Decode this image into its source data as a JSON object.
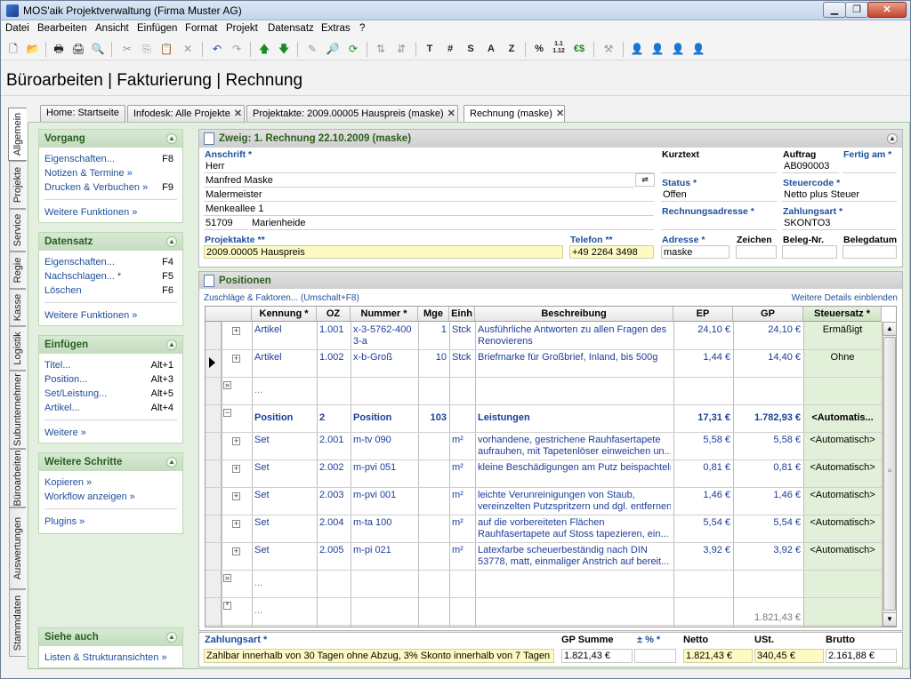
{
  "window": {
    "title": "MOS'aik Projektverwaltung (Firma Muster AG)"
  },
  "menu": [
    "Datei",
    "Bearbeiten",
    "Ansicht",
    "Einfügen",
    "Format",
    "Projekt",
    "Datensatz",
    "Extras",
    "?"
  ],
  "toolbar_text": [
    "T",
    "#",
    "S",
    "A",
    "Z",
    "%",
    "1.1 1.12",
    "€$"
  ],
  "page_title": "Büroarbeiten | Fakturierung | Rechnung",
  "vtabs": [
    "Allgemein",
    "Projekte",
    "Service",
    "Regie",
    "Kasse",
    "Logistik",
    "Subunternehmer",
    "Büroarbeiten",
    "Auswertungen",
    "Stammdaten"
  ],
  "doctabs": [
    {
      "label": "Home: Startseite",
      "closable": false
    },
    {
      "label": "Infodesk: Alle Projekte",
      "closable": true
    },
    {
      "label": "Projektakte: 2009.00005 Hauspreis (maske)",
      "closable": true
    },
    {
      "label": "Rechnung (maske)",
      "closable": true
    }
  ],
  "sidebar": {
    "vorgang": {
      "title": "Vorgang",
      "items": [
        {
          "label": "Eigenschaften...",
          "key": "F8"
        },
        {
          "label": "Notizen & Termine »",
          "key": ""
        },
        {
          "label": "Drucken & Verbuchen »",
          "key": "F9"
        }
      ],
      "more": "Weitere Funktionen »"
    },
    "datensatz": {
      "title": "Datensatz",
      "items": [
        {
          "label": "Eigenschaften...",
          "key": "F4"
        },
        {
          "label": "Nachschlagen... *",
          "key": "F5"
        },
        {
          "label": "Löschen",
          "key": "F6"
        }
      ],
      "more": "Weitere Funktionen »"
    },
    "einfuegen": {
      "title": "Einfügen",
      "items": [
        {
          "label": "Titel...",
          "key": "Alt+1"
        },
        {
          "label": "Position...",
          "key": "Alt+3"
        },
        {
          "label": "Set/Leistung...",
          "key": "Alt+5"
        },
        {
          "label": "Artikel...",
          "key": "Alt+4"
        }
      ],
      "more": "Weitere »"
    },
    "schritte": {
      "title": "Weitere Schritte",
      "items": [
        {
          "label": "Kopieren »",
          "key": ""
        },
        {
          "label": "Workflow anzeigen »",
          "key": ""
        }
      ],
      "more": "Plugins »"
    },
    "siehe": {
      "title": "Siehe auch",
      "items": [
        {
          "label": "Listen & Strukturansichten »",
          "key": ""
        }
      ]
    }
  },
  "zweig": {
    "title": "Zweig: 1. Rechnung 22.10.2009 (maske)",
    "anschrift_label": "Anschrift *",
    "anschrift": [
      "Herr",
      "Manfred Maske",
      "Malermeister",
      "Menkeallee 1"
    ],
    "plz": "51709",
    "ort": "Marienheide",
    "projektakte_label": "Projektakte **",
    "projektakte": "2009.00005 Hauspreis",
    "telefon_label": "Telefon **",
    "telefon": "+49 2264 3498",
    "kurztext_label": "Kurztext",
    "kurztext": "",
    "auftrag_label": "Auftrag",
    "auftrag": "AB090003",
    "fertig_label": "Fertig am *",
    "fertig": "",
    "status_label": "Status *",
    "status": "Offen",
    "steuercode_label": "Steuercode *",
    "steuercode": "Netto plus Steuer",
    "rechnungsadresse_label": "Rechnungsadresse *",
    "rechnungsadresse": "",
    "zahlungsart_label": "Zahlungsart *",
    "zahlungsart": "SKONTO3",
    "adresse_label": "Adresse *",
    "adresse": "maske",
    "zeichen_label": "Zeichen",
    "zeichen": "",
    "belegnr_label": "Beleg-Nr.",
    "belegnr": "",
    "belegdatum_label": "Belegdatum",
    "belegdatum": ""
  },
  "positionen": {
    "title": "Positionen",
    "link_left": "Zuschläge & Faktoren... (Umschalt+F8)",
    "link_right": "Weitere Details einblenden",
    "columns": [
      "Kennung *",
      "OZ",
      "Nummer *",
      "Mge",
      "Einh",
      "Beschreibung",
      "EP",
      "GP",
      "Steuersatz *"
    ],
    "rows": [
      {
        "kennung": "Artikel",
        "oz": "1.001",
        "nummer": "x-3-5762-400\n3-a",
        "mge": "1",
        "einh": "Stck",
        "beschreibung": "Ausführliche Antworten zu allen Fragen des\nRenovierens",
        "ep": "24,10 €",
        "gp": "24,10 €",
        "steuer": "Ermäßigt",
        "bold": false
      },
      {
        "kennung": "Artikel",
        "oz": "1.002",
        "nummer": "x-b-Groß",
        "mge": "10",
        "einh": "Stck",
        "beschreibung": "Briefmarke für Großbrief, Inland, bis 500g",
        "ep": "1,44 €",
        "gp": "14,40 €",
        "steuer": "Ohne",
        "bold": false
      },
      {
        "kennung": "...",
        "oz": "",
        "nummer": "",
        "mge": "",
        "einh": "",
        "beschreibung": "",
        "ep": "",
        "gp": "",
        "steuer": "",
        "bold": false
      },
      {
        "kennung": "Position",
        "oz": "2",
        "nummer": "Position",
        "mge": "103",
        "einh": "",
        "beschreibung": "Leistungen",
        "ep": "17,31 €",
        "gp": "1.782,93 €",
        "steuer": "<Automatis...",
        "bold": true
      },
      {
        "kennung": "Set",
        "oz": "2.001",
        "nummer": "m-tv 090",
        "mge": "",
        "einh": "m²",
        "beschreibung": "vorhandene, gestrichene Rauhfasertapete\naufrauhen, mit Tapetenlöser einweichen un...",
        "ep": "5,58 €",
        "gp": "5,58 €",
        "steuer": "<Automatisch>",
        "bold": false
      },
      {
        "kennung": "Set",
        "oz": "2.002",
        "nummer": "m-pvi 051",
        "mge": "",
        "einh": "m²",
        "beschreibung": "kleine Beschädigungen am Putz beispachteln",
        "ep": "0,81 €",
        "gp": "0,81 €",
        "steuer": "<Automatisch>",
        "bold": false
      },
      {
        "kennung": "Set",
        "oz": "2.003",
        "nummer": "m-pvi 001",
        "mge": "",
        "einh": "m²",
        "beschreibung": "leichte Verunreinigungen von Staub,\nvereinzelten Putzspritzern und dgl. entfernen",
        "ep": "1,46 €",
        "gp": "1,46 €",
        "steuer": "<Automatisch>",
        "bold": false
      },
      {
        "kennung": "Set",
        "oz": "2.004",
        "nummer": "m-ta 100",
        "mge": "",
        "einh": "m²",
        "beschreibung": "auf die vorbereiteten Flächen\nRauhfasertapete auf Stoss tapezieren, ein...",
        "ep": "5,54 €",
        "gp": "5,54 €",
        "steuer": "<Automatisch>",
        "bold": false
      },
      {
        "kennung": "Set",
        "oz": "2.005",
        "nummer": "m-pi 021",
        "mge": "",
        "einh": "m²",
        "beschreibung": "Latexfarbe scheuerbeständig nach DIN\n53778, matt, einmaliger Anstrich auf bereit...",
        "ep": "3,92 €",
        "gp": "3,92 €",
        "steuer": "<Automatisch>",
        "bold": false
      },
      {
        "kennung": "...",
        "oz": "",
        "nummer": "",
        "mge": "",
        "einh": "",
        "beschreibung": "",
        "ep": "",
        "gp": "",
        "steuer": "",
        "bold": false
      },
      {
        "kennung": "...",
        "oz": "",
        "nummer": "",
        "mge": "",
        "einh": "",
        "beschreibung": "",
        "ep": "",
        "gp": "1.821,43 €",
        "steuer": "",
        "bold": false
      }
    ]
  },
  "footer": {
    "zahlungsart_label": "Zahlungsart *",
    "zahlungsart": "Zahlbar innerhalb von 30 Tagen ohne Abzug, 3% Skonto innerhalb von 7 Tagen",
    "gpsumme_label": "GP Summe",
    "gpsumme": "1.821,43 €",
    "pct_label": "± % *",
    "pct": "",
    "netto_label": "Netto",
    "netto": "1.821,43 €",
    "ust_label": "USt.",
    "ust": "340,45 €",
    "brutto_label": "Brutto",
    "brutto": "2.161,88 €"
  }
}
